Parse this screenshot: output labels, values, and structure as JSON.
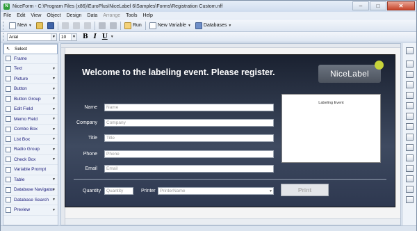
{
  "window": {
    "title": "NiceForm - C:\\Program Files (x86)\\EuroPlus\\NiceLabel 6\\Samples\\Forms\\Registration Custom.nff",
    "app_icon": "N"
  },
  "menu": [
    "File",
    "Edit",
    "View",
    "Object",
    "Design",
    "Data",
    "Arrange",
    "Tools",
    "Help"
  ],
  "menu_disabled": [
    "Arrange"
  ],
  "toolbar": {
    "new_label": "New",
    "run_label": "Run",
    "new_variable_label": "New Variable",
    "databases_label": "Databases"
  },
  "format_bar": {
    "font": "Arial",
    "size": "10",
    "bold": "B",
    "italic": "I",
    "underline": "U"
  },
  "tools": [
    {
      "label": "Select",
      "key": "S"
    },
    {
      "label": "Frame",
      "key": "F"
    },
    {
      "label": "Text",
      "key": "T"
    },
    {
      "label": "Picture",
      "key": "P"
    },
    {
      "label": "Button",
      "key": "B"
    },
    {
      "label": "Button Group",
      "key": "B"
    },
    {
      "label": "Edit Field",
      "key": "E"
    },
    {
      "label": "Memo Field",
      "key": "M"
    },
    {
      "label": "Combo Box",
      "key": "C"
    },
    {
      "label": "List Box",
      "key": "L"
    },
    {
      "label": "Radio Group",
      "key": "R"
    },
    {
      "label": "Check Box",
      "key": "C"
    },
    {
      "label": "Variable Prompt",
      "key": "V"
    },
    {
      "label": "Table",
      "key": "T"
    },
    {
      "label": "Database Navigator",
      "key": "D"
    },
    {
      "label": "Database Search",
      "key": "D"
    },
    {
      "label": "Preview",
      "key": "P"
    }
  ],
  "form": {
    "welcome": "Welcome to the labeling event. Please register.",
    "logo": "NiceLabel",
    "fields": [
      {
        "label": "Name",
        "placeholder": "Name"
      },
      {
        "label": "Company",
        "placeholder": "Company"
      },
      {
        "label": "Title",
        "placeholder": "Title"
      },
      {
        "label": "Phone",
        "placeholder": "Phone"
      },
      {
        "label": "Email",
        "placeholder": "Email"
      }
    ],
    "preview_label": "Labeling Event",
    "quantity_label": "Quantity",
    "quantity_placeholder": "Quantity",
    "printer_label": "Printer",
    "printer_placeholder": "PrinterName",
    "print_button": "Print"
  },
  "colors": {
    "form_bg": "#2e3850",
    "logo_accent": "#c8d43a",
    "tool_text": "#1a1a7a"
  }
}
